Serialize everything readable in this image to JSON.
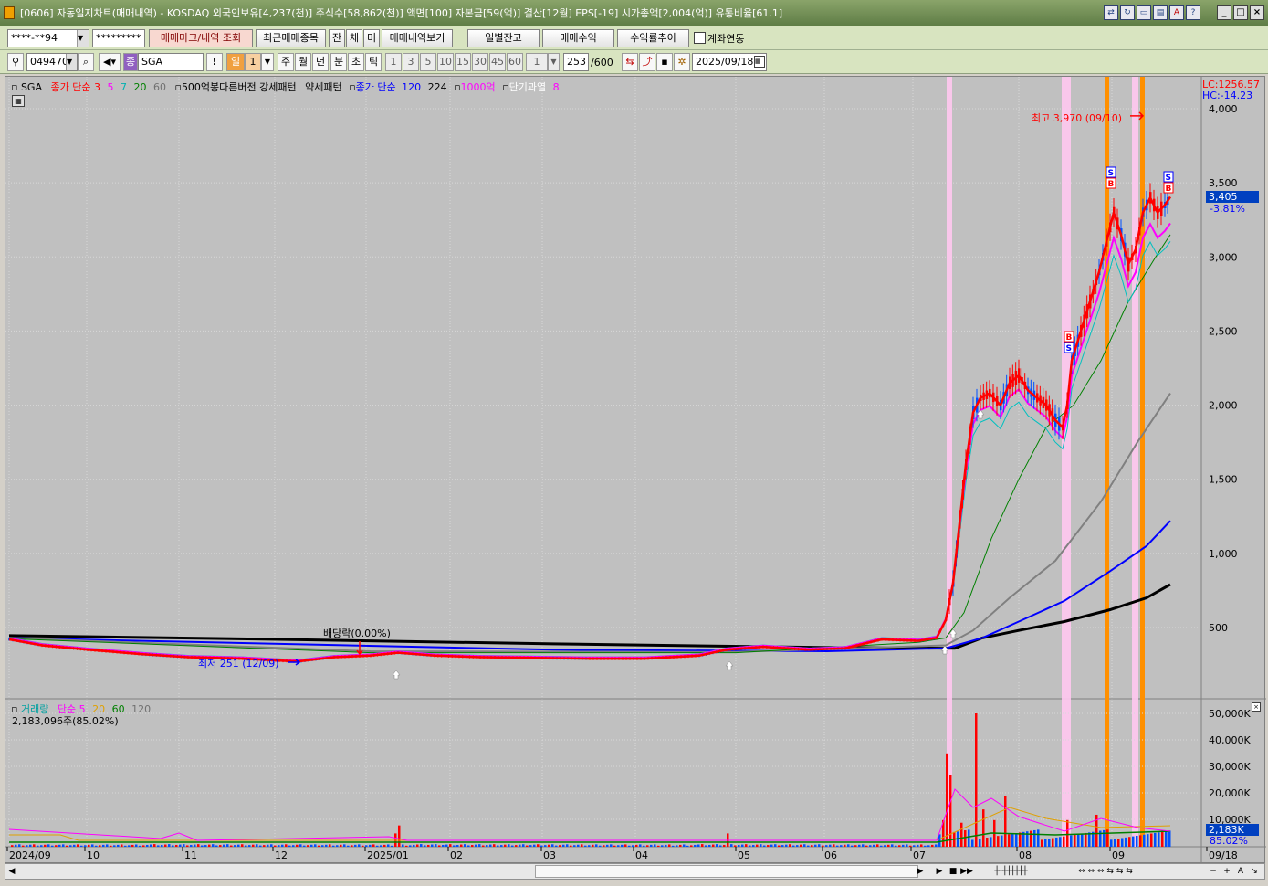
{
  "window": {
    "title": "[0606] 자동일지차트(매매내역) - KOSDAQ 외국인보유[4,237(천)] 주식수[58,862(천)] 액면[100] 자본금[59(억)] 결산[12월] EPS[-19] 시가총액[2,004(억)] 유통비율[61.1]"
  },
  "toolbar1": {
    "account": "****-**94",
    "password": "*********",
    "btn_mark": "매매마크/내역 조회",
    "btn_recent": "최근매매종목",
    "btn_jan": "잔",
    "btn_che": "체",
    "btn_mi": "미",
    "btn_detail": "매매내역보기",
    "btn_daily": "일별잔고",
    "btn_profit": "매매수익",
    "btn_rate": "수익률추이",
    "chk_link": "계좌연동"
  },
  "toolbar2": {
    "code": "049470",
    "name": "SGA",
    "name_prefix": "종",
    "period_sel": "일",
    "period_num": "1",
    "periods": [
      "주",
      "월",
      "년",
      "분",
      "초",
      "틱"
    ],
    "minutes": [
      "1",
      "3",
      "5",
      "10",
      "15",
      "30",
      "45",
      "60"
    ],
    "interval": "1",
    "count": "253",
    "count_max": "/600",
    "date": "2025/09/18"
  },
  "legend": {
    "sga": "SGA",
    "ma_label": "종가 단순",
    "ma3": "3",
    "ma5": "5",
    "ma7": "7",
    "ma20": "20",
    "ma60": "60",
    "pattern": "500억봉다른버전 강세패턴",
    "weak": "약세패턴",
    "ma_label2": "종가 단순",
    "ma120": "120",
    "ma224": "224",
    "ma1000": "1000억",
    "short_over": "단기과열",
    "short_n": "8",
    "vol_label": "거래량",
    "vol_ma_label": "단순 5",
    "vol_20": "20",
    "vol_60": "60",
    "vol_120": "120",
    "vol_value": "2,183,096주(85.02%)"
  },
  "right_info": {
    "lc": "LC:1256.57",
    "hc": "HC:-14.23",
    "price": "3,405",
    "change": "-3.81%",
    "vol_now": "2,183K",
    "vol_pct": "85.02%"
  },
  "annotations": {
    "high": "최고 3,970 (09/10)",
    "low": "최저 251 (12/09)",
    "dividend": "배당락(0.00%)"
  },
  "colors": {
    "ma3": "#ff0000",
    "ma5": "#ff00ff",
    "ma7": "#00c0c0",
    "ma20": "#008000",
    "ma60": "#808080",
    "ma120": "#0000ff",
    "ma224": "#000000",
    "up": "#ff0000",
    "down": "#0050ff",
    "pink_band": "#ffc8f0",
    "orange_band": "#ff9000"
  },
  "chart_data": {
    "type": "line",
    "title": "",
    "y_ticks": [
      "4,000",
      "3,500",
      "3,000",
      "2,500",
      "2,000",
      "1,500",
      "1,000",
      "500"
    ],
    "ylim": [
      0,
      4100
    ],
    "x_ticks": [
      "2024/09",
      "10",
      "11",
      "12",
      "2025/01",
      "02",
      "03",
      "04",
      "05",
      "06",
      "07",
      "08",
      "09",
      "09/18"
    ],
    "vol_ticks": [
      "50,000K",
      "40,000K",
      "30,000K",
      "20,000K",
      "10,000K"
    ],
    "series": [
      {
        "name": "3",
        "x": [
          "2024/09",
          "10",
          "11",
          "12",
          "2025/01",
          "02",
          "03",
          "04",
          "05",
          "06",
          "07/10",
          "07/20",
          "07/25",
          "08",
          "08/20",
          "09",
          "09/10",
          "09/18"
        ],
        "values": [
          420,
          350,
          300,
          280,
          330,
          310,
          300,
          290,
          350,
          380,
          500,
          1800,
          2050,
          2150,
          1900,
          3000,
          3300,
          3405
        ]
      },
      {
        "name": "120",
        "x": [
          "2024/09",
          "12",
          "2025/03",
          "06",
          "07",
          "08",
          "09",
          "09/18"
        ],
        "values": [
          430,
          380,
          330,
          340,
          360,
          700,
          1000,
          1220
        ]
      },
      {
        "name": "224",
        "x": [
          "2024/09",
          "12",
          "2025/03",
          "06",
          "07",
          "08",
          "09",
          "09/18"
        ],
        "values": [
          440,
          410,
          370,
          350,
          350,
          500,
          650,
          790
        ]
      }
    ]
  }
}
